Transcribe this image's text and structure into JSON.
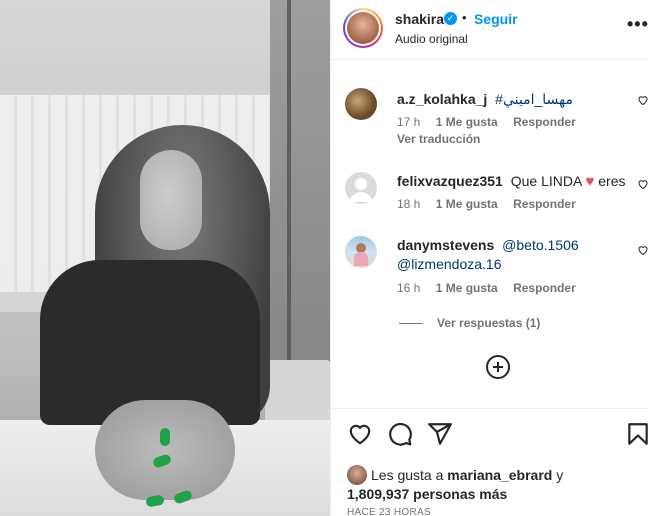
{
  "post": {
    "author": "shakira",
    "verified_mark": "✓",
    "dot": "•",
    "follow_label": "Seguir",
    "audio_label": "Audio original",
    "more_label": "•••"
  },
  "comments": [
    {
      "user": "a.z_kolahka_j",
      "text": "#مهسا_اميني",
      "time": "17 h",
      "likes": "1 Me gusta",
      "reply": "Responder",
      "translate": "Ver traducción"
    },
    {
      "user": "felixvazquez351",
      "text_before": "Que LINDA",
      "heart": "♥",
      "text_after": "eres",
      "time": "18 h",
      "likes": "1 Me gusta",
      "reply": "Responder"
    },
    {
      "user": "danymstevens",
      "mention1": "@beto.1506",
      "mention2": "@lizmendoza.16",
      "time": "16 h",
      "likes": "1 Me gusta",
      "reply": "Responder",
      "view_replies": "Ver respuestas (1)"
    }
  ],
  "footer": {
    "likes_prefix": "Les gusta a",
    "liked_by": "mariana_ebrard",
    "likes_conj": "y",
    "likes_count": "1,809,937 personas más",
    "timestamp": "HACE 23 HORAS"
  },
  "icons": {
    "like": "heart-icon",
    "comment": "comment-icon",
    "share": "share-icon",
    "save": "bookmark-icon",
    "load_more": "plus-circle-icon"
  },
  "colors": {
    "accent": "#0095f6",
    "mention": "#00376b",
    "heart_red": "#ed4956",
    "nails": "#1ea34a"
  }
}
